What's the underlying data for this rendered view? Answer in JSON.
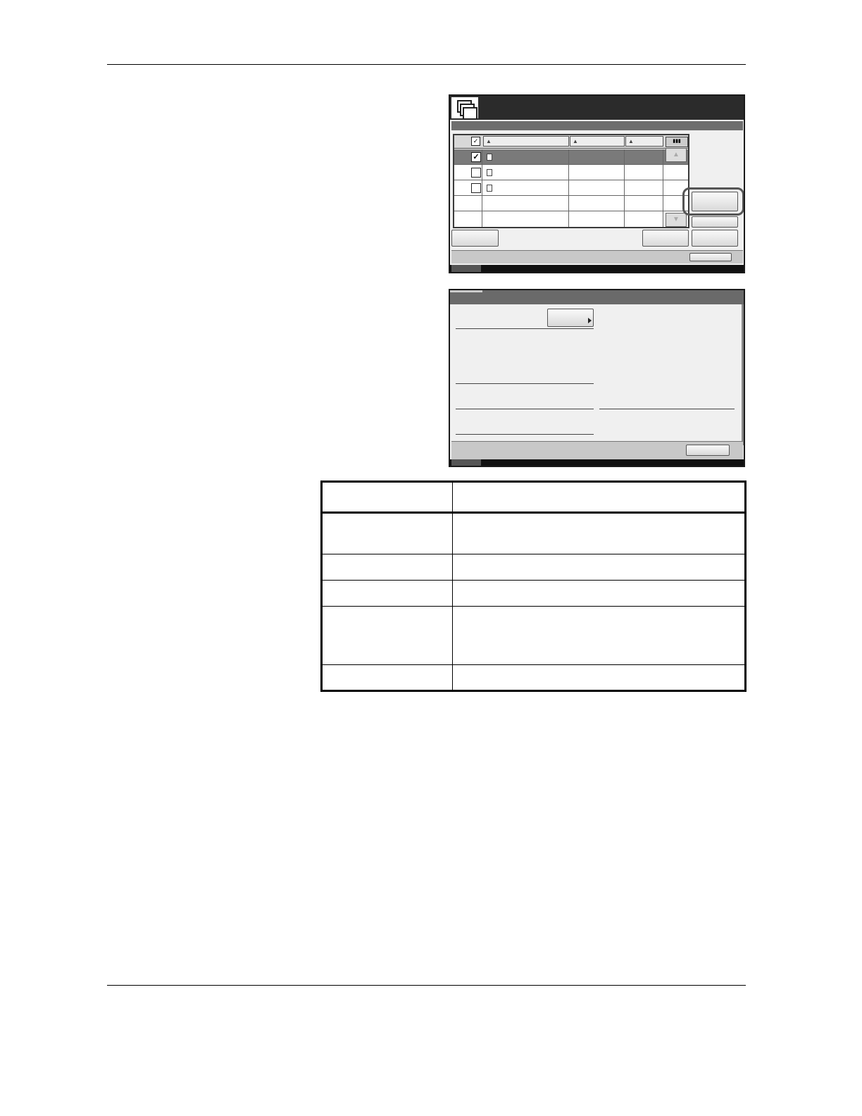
{
  "page": {
    "header_rule": true,
    "footer_rule": true
  },
  "panel_list": {
    "icon": "document-box-icon",
    "header_check_icon": "checkbox-checked-icon",
    "rows": [
      {
        "checked": true,
        "selected": true,
        "icon": "document-icon"
      },
      {
        "checked": false,
        "selected": false,
        "icon": "document-icon"
      },
      {
        "checked": false,
        "selected": false,
        "icon": "document-icon"
      },
      {
        "checked": null,
        "selected": false,
        "icon": ""
      },
      {
        "checked": null,
        "selected": false,
        "icon": ""
      }
    ],
    "scroll_up_icon": "triangle-up-icon",
    "scroll_down_icon": "triangle-down-icon",
    "view_toggle_icon": "list-view-icon"
  },
  "panel_detail": {
    "arrow_icon": "arrow-right-icon"
  },
  "table": {
    "rows": 6
  },
  "colors": {
    "title_bar": "#2b2b2b",
    "selected_row": "#7a7a7a",
    "panel_bg": "#f0f0f0"
  }
}
